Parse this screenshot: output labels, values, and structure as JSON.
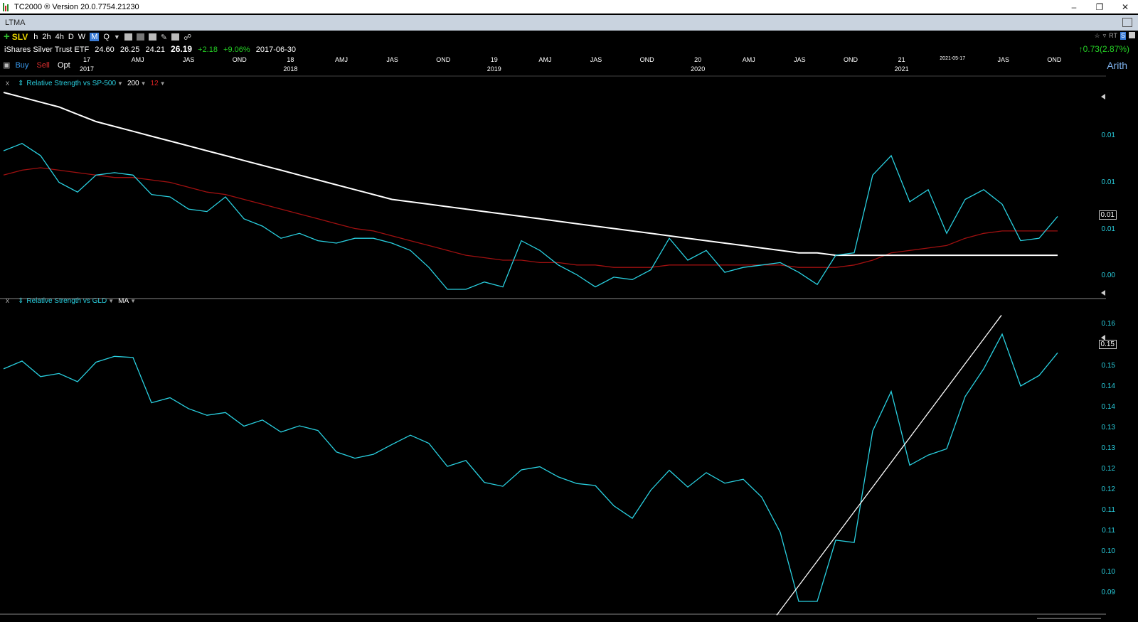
{
  "window": {
    "title": "TC2000 ® Version 20.0.7754.21230"
  },
  "layout": {
    "name": "LTMA"
  },
  "toolbar": {
    "symbol": "SLV",
    "timeframes": [
      "h",
      "2h",
      "4h",
      "D",
      "W",
      "M",
      "Q"
    ],
    "active_timeframe": "M"
  },
  "quote": {
    "name": "iShares Silver Trust ETF",
    "open": "24.60",
    "high": "26.25",
    "low": "24.21",
    "close": "26.19",
    "change": "+2.18",
    "change_pct": "+9.06%",
    "date": "2017-06-30",
    "right_change": "0.73(2.87%)"
  },
  "trade": {
    "buy": "Buy",
    "sell": "Sell",
    "opt": "Opt"
  },
  "scale_mode": "Arith",
  "axis": {
    "ticks": [
      {
        "top": "17",
        "bottom": "2017"
      },
      {
        "top": "AMJ",
        "bottom": ""
      },
      {
        "top": "JAS",
        "bottom": ""
      },
      {
        "top": "OND",
        "bottom": ""
      },
      {
        "top": "18",
        "bottom": "2018"
      },
      {
        "top": "AMJ",
        "bottom": ""
      },
      {
        "top": "JAS",
        "bottom": ""
      },
      {
        "top": "OND",
        "bottom": ""
      },
      {
        "top": "19",
        "bottom": "2019"
      },
      {
        "top": "AMJ",
        "bottom": ""
      },
      {
        "top": "JAS",
        "bottom": ""
      },
      {
        "top": "OND",
        "bottom": ""
      },
      {
        "top": "20",
        "bottom": "2020"
      },
      {
        "top": "AMJ",
        "bottom": ""
      },
      {
        "top": "JAS",
        "bottom": ""
      },
      {
        "top": "OND",
        "bottom": ""
      },
      {
        "top": "21",
        "bottom": "2021"
      },
      {
        "top": "2021-05-17",
        "bottom": ""
      },
      {
        "top": "JAS",
        "bottom": ""
      },
      {
        "top": "OND",
        "bottom": ""
      }
    ]
  },
  "panel1": {
    "title": "Relative Strength vs SP-500",
    "param1": "200",
    "param2": "12",
    "y_labels": [
      "0.01",
      "0.01",
      "0.01",
      "0.00"
    ],
    "current_label": "0.01"
  },
  "panel2": {
    "title": "Relative Strength vs GLD",
    "param1": "MA",
    "y_labels": [
      "0.16",
      "0.15",
      "0.14",
      "0.14",
      "0.13",
      "0.13",
      "0.12",
      "0.12",
      "0.11",
      "0.11",
      "0.10",
      "0.10",
      "0.09"
    ],
    "current_label": "0.15"
  },
  "chart_data": [
    {
      "type": "line",
      "title": "Relative Strength vs SP-500",
      "series": [
        {
          "name": "Relative Strength vs SP-500",
          "color": "#29d0e0",
          "values": [
            0.0128,
            0.0131,
            0.0126,
            0.0115,
            0.0111,
            0.0118,
            0.0119,
            0.0118,
            0.011,
            0.0109,
            0.0104,
            0.0103,
            0.0109,
            0.01,
            0.0097,
            0.0092,
            0.0094,
            0.0091,
            0.009,
            0.0092,
            0.0092,
            0.009,
            0.0087,
            0.008,
            0.0071,
            0.0071,
            0.0074,
            0.0072,
            0.0091,
            0.0087,
            0.0081,
            0.0077,
            0.0072,
            0.0076,
            0.0075,
            0.0079,
            0.0092,
            0.0083,
            0.0087,
            0.0078,
            0.008,
            0.0081,
            0.0082,
            0.0078,
            0.0073,
            0.0085,
            0.0086,
            0.0118,
            0.0126,
            0.0107,
            0.0112,
            0.0094,
            0.0108,
            0.0112,
            0.0106,
            0.0091,
            0.0092,
            0.0101
          ]
        },
        {
          "name": "200",
          "color": "#ffffff",
          "values": [
            0.0152,
            0.015,
            0.0148,
            0.0146,
            0.0143,
            0.014,
            0.0138,
            0.0136,
            0.0134,
            0.0132,
            0.013,
            0.0128,
            0.0126,
            0.0124,
            0.0122,
            0.012,
            0.0118,
            0.0116,
            0.0114,
            0.0112,
            0.011,
            0.0108,
            0.0107,
            0.0106,
            0.0105,
            0.0104,
            0.0103,
            0.0102,
            0.0101,
            0.01,
            0.0099,
            0.0098,
            0.0097,
            0.0096,
            0.0095,
            0.0094,
            0.0093,
            0.0092,
            0.0091,
            0.009,
            0.0089,
            0.0088,
            0.0087,
            0.0086,
            0.0086,
            0.0085,
            0.0085,
            0.0085,
            0.0085,
            0.0085,
            0.0085,
            0.0085,
            0.0085,
            0.0085,
            0.0085,
            0.0085,
            0.0085,
            0.0085
          ]
        },
        {
          "name": "12",
          "color": "#a01010",
          "values": [
            0.0118,
            0.012,
            0.0121,
            0.012,
            0.0119,
            0.0118,
            0.0117,
            0.0117,
            0.0116,
            0.0115,
            0.0113,
            0.0111,
            0.011,
            0.0108,
            0.0106,
            0.0104,
            0.0102,
            0.01,
            0.0098,
            0.0096,
            0.0095,
            0.0093,
            0.0091,
            0.0089,
            0.0087,
            0.0085,
            0.0084,
            0.0083,
            0.0083,
            0.0082,
            0.0082,
            0.0081,
            0.0081,
            0.008,
            0.008,
            0.008,
            0.0081,
            0.0081,
            0.0081,
            0.0081,
            0.0081,
            0.0081,
            0.0081,
            0.008,
            0.008,
            0.008,
            0.0081,
            0.0083,
            0.0086,
            0.0087,
            0.0088,
            0.0089,
            0.0092,
            0.0094,
            0.0095,
            0.0095,
            0.0095,
            0.0095
          ]
        }
      ]
    },
    {
      "type": "line",
      "title": "Relative Strength vs GLD",
      "series": [
        {
          "name": "Relative Strength vs GLD",
          "color": "#29d0e0",
          "values": [
            0.1475,
            0.1495,
            0.1455,
            0.1463,
            0.1442,
            0.1492,
            0.1507,
            0.1504,
            0.1388,
            0.1401,
            0.1373,
            0.1356,
            0.1363,
            0.1328,
            0.1344,
            0.1313,
            0.1329,
            0.1317,
            0.1262,
            0.1246,
            0.1256,
            0.1281,
            0.1305,
            0.1284,
            0.1225,
            0.124,
            0.1184,
            0.1174,
            0.1216,
            0.1224,
            0.1198,
            0.1181,
            0.1176,
            0.1124,
            0.1092,
            0.1164,
            0.1215,
            0.1172,
            0.1209,
            0.1182,
            0.1192,
            0.1146,
            0.1056,
            0.0879,
            0.0879,
            0.1036,
            0.103,
            0.1316,
            0.1417,
            0.1228,
            0.1254,
            0.127,
            0.1404,
            0.1475,
            0.1564,
            0.1431,
            0.1458,
            0.1516
          ]
        },
        {
          "name": "trendline",
          "color": "#ffffff",
          "values": [
            0.0871,
            0.1596
          ]
        }
      ]
    }
  ]
}
